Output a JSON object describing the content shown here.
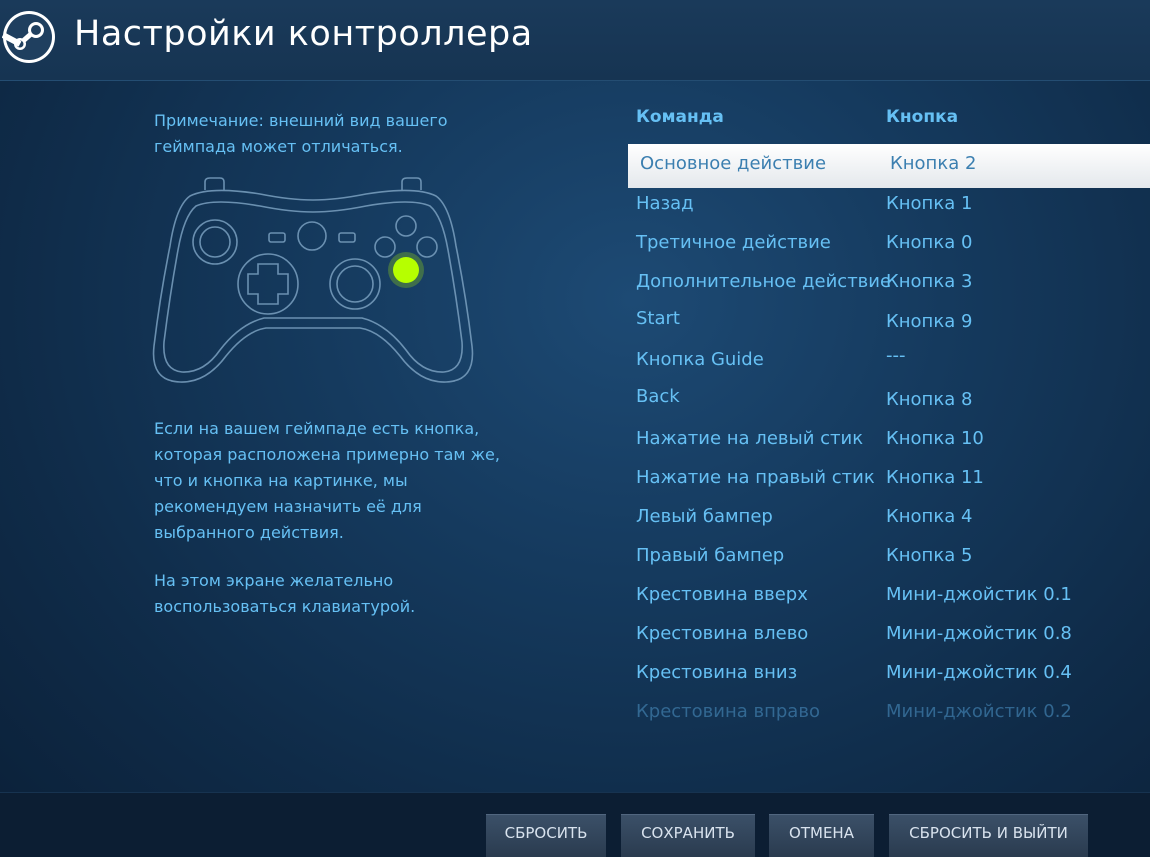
{
  "header": {
    "title": "Настройки контроллера",
    "logo_icon": "steam-logo-icon"
  },
  "left_panel": {
    "note": "Примечание: внешний вид вашего геймпада может отличаться.",
    "hint_1": "Если на вашем геймпаде есть кнопка, которая расположена примерно там же, что и кнопка на картинке, мы рекомендуем назначить её для выбранного действия.",
    "hint_2": "На этом экране желательно воспользоваться клавиатурой.",
    "highlight_color": "#b6ff00"
  },
  "mapping": {
    "col_command": "Команда",
    "col_button": "Кнопка",
    "rows": [
      {
        "command": "Основное действие",
        "button": "Кнопка 2"
      },
      {
        "command": "Назад",
        "button": "Кнопка 1"
      },
      {
        "command": "Третичное действие",
        "button": "Кнопка 0"
      },
      {
        "command": "Дополнительное действие",
        "button": "Кнопка 3"
      },
      {
        "command": "Start",
        "button": "Кнопка 9"
      },
      {
        "command": "Кнопка Guide",
        "button": "---"
      },
      {
        "command": "Back",
        "button": "Кнопка 8"
      },
      {
        "command": "Нажатие на левый стик",
        "button": "Кнопка 10"
      },
      {
        "command": "Нажатие на правый стик",
        "button": "Кнопка 11"
      },
      {
        "command": "Левый бампер",
        "button": "Кнопка 4"
      },
      {
        "command": "Правый бампер",
        "button": "Кнопка 5"
      },
      {
        "command": "Крестовина вверх",
        "button": "Мини-джойстик 0.1"
      },
      {
        "command": "Крестовина влево",
        "button": "Мини-джойстик 0.8"
      },
      {
        "command": "Крестовина вниз",
        "button": "Мини-джойстик 0.4"
      },
      {
        "command": "Крестовина вправо",
        "button": "Мини-джойстик 0.2"
      }
    ]
  },
  "footer": {
    "reset": "СБРОСИТЬ",
    "save": "СОХРАНИТЬ",
    "cancel": "ОТМЕНА",
    "reset_exit": "СБРОСИТЬ И ВЫЙТИ"
  }
}
